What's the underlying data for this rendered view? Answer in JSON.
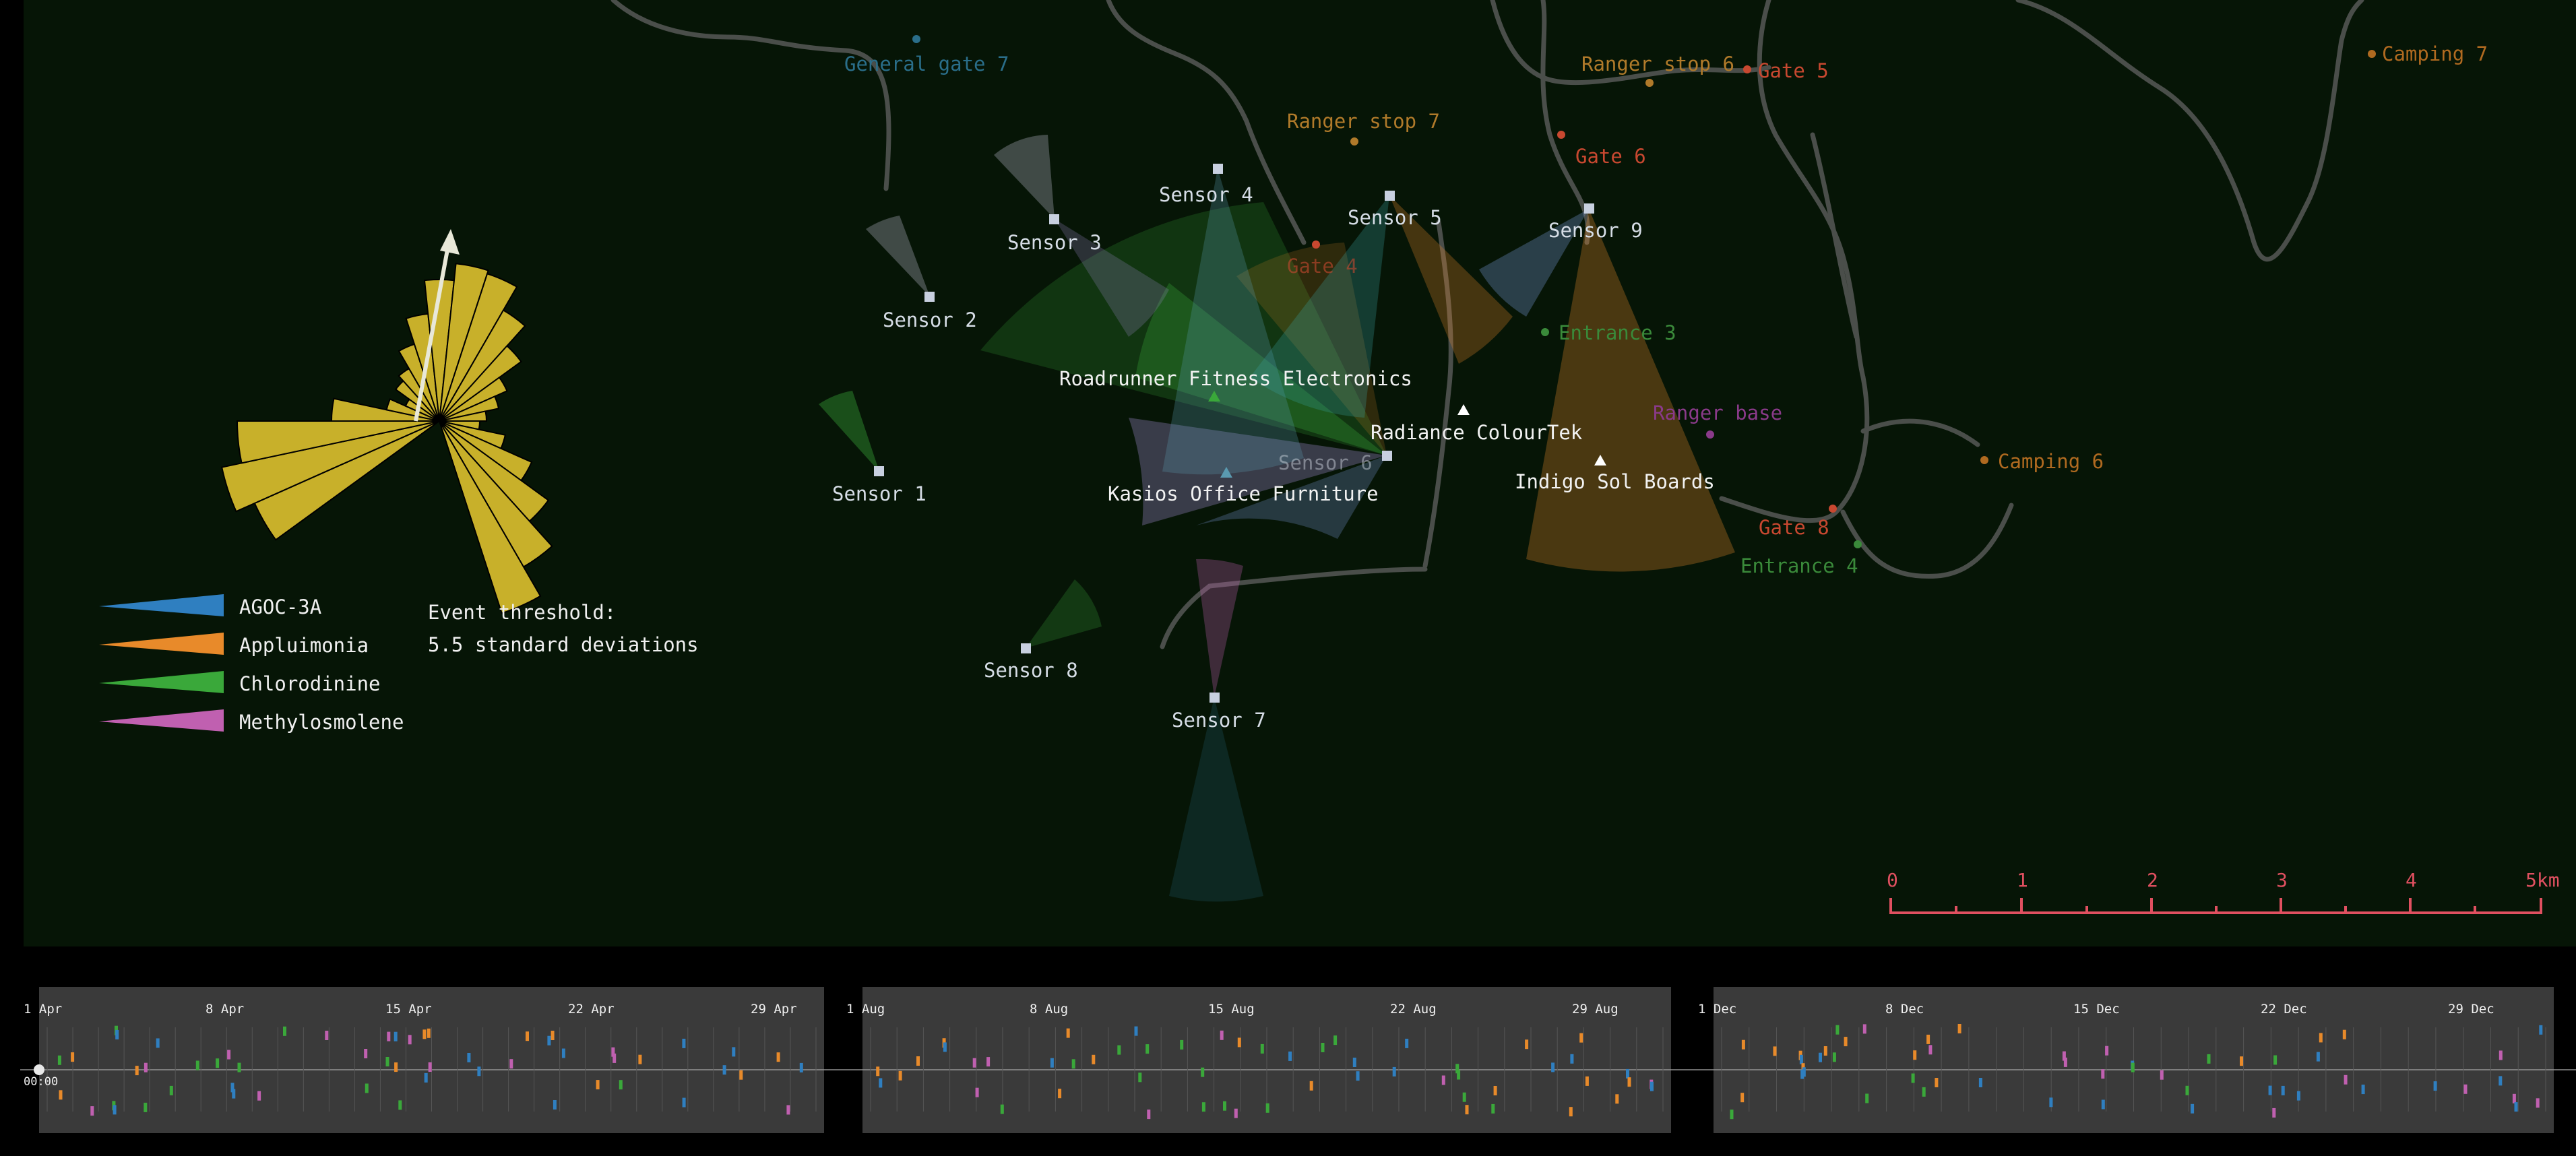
{
  "colors": {
    "background": "#061506",
    "agoc": "#2f7fc0",
    "appluimonia": "#e88a2a",
    "chlorodinine": "#3aa83a",
    "methylosmolene": "#c060b0",
    "rose": "#c8b02a",
    "scale": "#e05060",
    "timeline_bg": "#3a3a3a"
  },
  "sensors": [
    "Sensor 1",
    "Sensor 2",
    "Sensor 3",
    "Sensor 4",
    "Sensor 5",
    "Sensor 6",
    "Sensor 7",
    "Sensor 8",
    "Sensor 9"
  ],
  "factories": [
    "Roadrunner Fitness Electronics",
    "Radiance ColourTek",
    "Kasios Office Furniture",
    "Indigo Sol Boards"
  ],
  "places": [
    {
      "name": "General gate 7",
      "color": "#2a6e8a"
    },
    {
      "name": "Ranger stop 6",
      "color": "#b07a2a"
    },
    {
      "name": "Gate 5",
      "color": "#c84830"
    },
    {
      "name": "Camping 7",
      "color": "#b06a20"
    },
    {
      "name": "Ranger stop 7",
      "color": "#b07a2a"
    },
    {
      "name": "Gate 6",
      "color": "#c84830"
    },
    {
      "name": "Gate 4",
      "color": "#c84830"
    },
    {
      "name": "Entrance 3",
      "color": "#3a8a3a"
    },
    {
      "name": "Ranger base",
      "color": "#8a3a8a"
    },
    {
      "name": "Camping 6",
      "color": "#b06a20"
    },
    {
      "name": "Gate 8",
      "color": "#c84830"
    },
    {
      "name": "Entrance 4",
      "color": "#3a8a3a"
    }
  ],
  "legend": [
    {
      "label": "AGOC-3A",
      "color": "#2f7fc0"
    },
    {
      "label": "Appluimonia",
      "color": "#e88a2a"
    },
    {
      "label": "Chlorodinine",
      "color": "#3aa83a"
    },
    {
      "label": "Methylosmolene",
      "color": "#c060b0"
    }
  ],
  "threshold": {
    "line1": "Event threshold:",
    "line2": "5.5 standard deviations"
  },
  "scale": {
    "ticks": [
      "0",
      "1",
      "2",
      "3",
      "4",
      "5km"
    ]
  },
  "timelines": [
    {
      "month": "April",
      "dates": [
        "1 Apr",
        "8 Apr",
        "15 Apr",
        "22 Apr",
        "29 Apr"
      ]
    },
    {
      "month": "August",
      "dates": [
        "1 Aug",
        "8 Aug",
        "15 Aug",
        "22 Aug",
        "29 Aug"
      ]
    },
    {
      "month": "December",
      "dates": [
        "1 Dec",
        "8 Dec",
        "15 Dec",
        "22 Dec",
        "29 Dec"
      ]
    }
  ],
  "time_label": "00:00"
}
